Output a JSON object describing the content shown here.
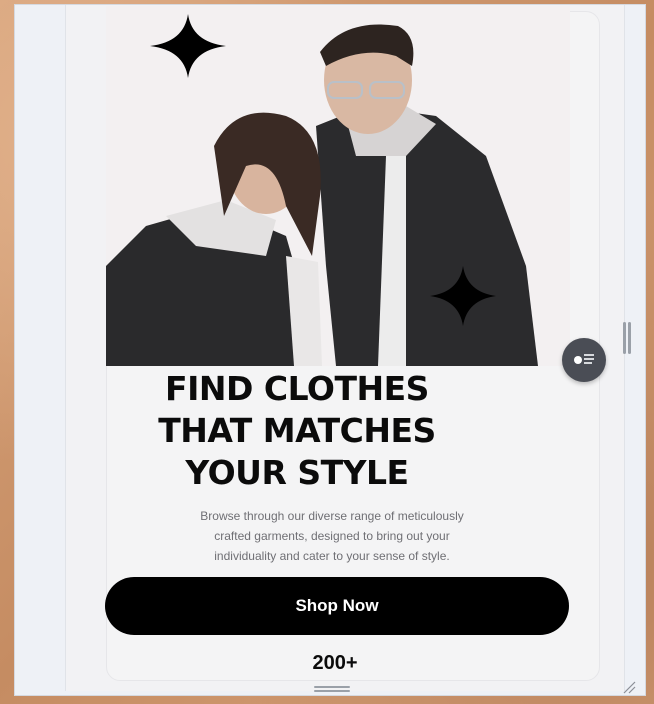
{
  "hero": {
    "image_alt": "Two models in dark denim jackets over white hoodies"
  },
  "icons": {
    "sparkle_large": "sparkle-icon",
    "sparkle_small": "sparkle-icon",
    "fab": "settings-fab-icon",
    "scroll": "vertical-drag-handle",
    "bottom": "horizontal-drag-handle",
    "resize": "resize-grip-icon"
  },
  "headline": {
    "line1": "FIND CLOTHES",
    "line2": "THAT MATCHES",
    "line3": "YOUR STYLE"
  },
  "subtext": {
    "line1": "Browse through our diverse range of meticulously",
    "line2": "crafted garments, designed to bring out your",
    "line3": "individuality and cater to your sense of style."
  },
  "cta": {
    "label": "Shop Now"
  },
  "stats": {
    "first_value": "200+"
  },
  "colors": {
    "button_bg": "#000000",
    "button_text": "#ffffff",
    "headline": "#0b0b0b",
    "subtext": "#6f6f74",
    "background": "#f4f4f5"
  }
}
